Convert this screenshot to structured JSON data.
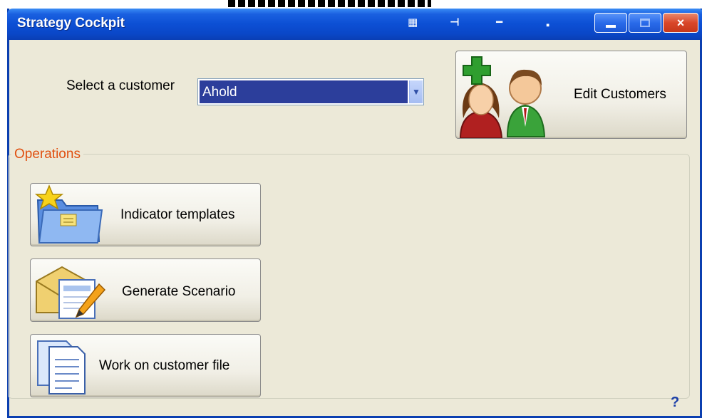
{
  "window": {
    "title": "Strategy Cockpit",
    "title_icons": [
      "film-icon",
      "pin-icon",
      "dash-icon",
      "dot-icon"
    ],
    "buttons": {
      "minimize": "minimize",
      "maximize": "maximize",
      "close": "×"
    }
  },
  "customer": {
    "label": "Select a customer",
    "selected": "Ahold"
  },
  "edit_customers": {
    "label": "Edit Customers"
  },
  "operations": {
    "title": "Operations",
    "items": [
      {
        "label": "Indicator templates",
        "icon": "folder-star-icon"
      },
      {
        "label": "Generate Scenario",
        "icon": "envelope-pencil-icon"
      },
      {
        "label": "Work on customer file",
        "icon": "documents-icon"
      }
    ]
  },
  "help": {
    "label": "?"
  },
  "colors": {
    "titlebar": "#0c4fd4",
    "window_bg": "#ece9d8",
    "selection": "#2c3e9b",
    "group_title": "#e05010",
    "help": "#1a3ea8"
  }
}
